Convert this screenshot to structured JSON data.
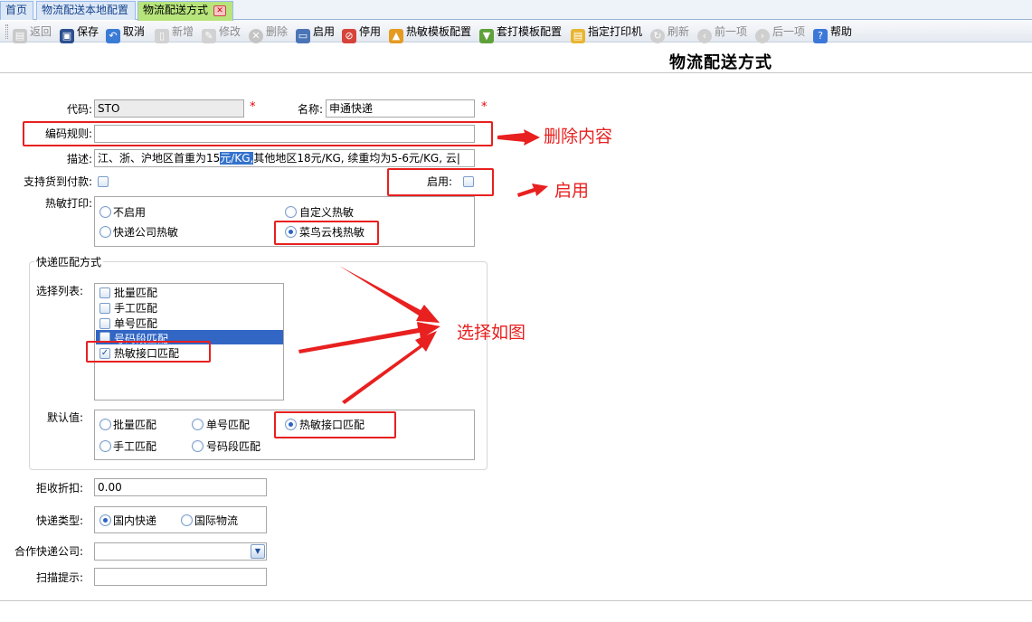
{
  "tabs": [
    {
      "label": "首页",
      "active": false
    },
    {
      "label": "物流配送本地配置",
      "active": false
    },
    {
      "label": "物流配送方式",
      "active": true,
      "closable": true
    }
  ],
  "toolbar": [
    {
      "label": "返回",
      "icon": "back-icon",
      "enabled": false
    },
    {
      "label": "保存",
      "icon": "save-icon",
      "enabled": true
    },
    {
      "label": "取消",
      "icon": "undo-icon",
      "enabled": true
    },
    {
      "label": "新增",
      "icon": "new-document-icon",
      "enabled": false
    },
    {
      "label": "修改",
      "icon": "edit-icon",
      "enabled": false
    },
    {
      "label": "删除",
      "icon": "delete-icon",
      "enabled": false
    },
    {
      "label": "启用",
      "icon": "monitor-icon",
      "enabled": true
    },
    {
      "label": "停用",
      "icon": "stop-icon",
      "enabled": true
    },
    {
      "label": "热敏模板配置",
      "icon": "thermal-template-icon",
      "enabled": true
    },
    {
      "label": "套打模板配置",
      "icon": "print-template-icon",
      "enabled": true
    },
    {
      "label": "指定打印机",
      "icon": "printer-icon",
      "enabled": true
    },
    {
      "label": "刷新",
      "icon": "refresh-icon",
      "enabled": false
    },
    {
      "label": "前一项",
      "icon": "prev-icon",
      "enabled": false
    },
    {
      "label": "后一项",
      "icon": "next-icon",
      "enabled": false
    },
    {
      "label": "帮助",
      "icon": "help-icon",
      "enabled": true
    }
  ],
  "page_title": "物流配送方式",
  "form": {
    "code": {
      "label": "代码:",
      "value": "STO",
      "required_mark": "*"
    },
    "name": {
      "label": "名称:",
      "value": "申通快递",
      "required_mark": "*"
    },
    "code_rule": {
      "label": "编码规则:",
      "value": ""
    },
    "description": {
      "label": "描述:",
      "value_before": "江、浙、沪地区首重为15",
      "value_selected": "元/KG,",
      "value_after": "其他地区18元/KG, 续重均为5-6元/KG, 云|"
    },
    "cod": {
      "label": "支持货到付款:",
      "checked": false
    },
    "enabled": {
      "label": "启用:",
      "checked": false
    },
    "thermal_print": {
      "label": "热敏打印:",
      "options": [
        {
          "label": "不启用",
          "selected": false
        },
        {
          "label": "自定义热敏",
          "selected": false
        },
        {
          "label": "快递公司热敏",
          "selected": false
        },
        {
          "label": "菜鸟云栈热敏",
          "selected": true
        }
      ]
    },
    "match_group": {
      "legend": "快递匹配方式",
      "select_list": {
        "label": "选择列表:",
        "items": [
          {
            "label": "批量匹配",
            "checked": false,
            "highlighted": false
          },
          {
            "label": "手工匹配",
            "checked": false,
            "highlighted": false
          },
          {
            "label": "单号匹配",
            "checked": false,
            "highlighted": false
          },
          {
            "label": "号码段匹配",
            "checked": false,
            "highlighted": true
          },
          {
            "label": "热敏接口匹配",
            "checked": true,
            "highlighted": false
          }
        ]
      },
      "default_value": {
        "label": "默认值:",
        "options": [
          {
            "label": "批量匹配",
            "selected": false
          },
          {
            "label": "单号匹配",
            "selected": false
          },
          {
            "label": "热敏接口匹配",
            "selected": true
          },
          {
            "label": "手工匹配",
            "selected": false
          },
          {
            "label": "号码段匹配",
            "selected": false
          }
        ]
      }
    },
    "reject_discount": {
      "label": "拒收折扣:",
      "value": "0.00"
    },
    "express_type": {
      "label": "快递类型:",
      "options": [
        {
          "label": "国内快递",
          "selected": true
        },
        {
          "label": "国际物流",
          "selected": false
        }
      ]
    },
    "partner_company": {
      "label": "合作快递公司:",
      "value": ""
    },
    "scan_hint": {
      "label": "扫描提示:",
      "value": ""
    }
  },
  "annotations": {
    "delete_content": "删除内容",
    "enable": "启用",
    "select_as_shown": "选择如图"
  },
  "colors": {
    "annotation_red": "#e8201f",
    "active_tab": "#b7e57c",
    "selection_blue": "#3166c4"
  }
}
